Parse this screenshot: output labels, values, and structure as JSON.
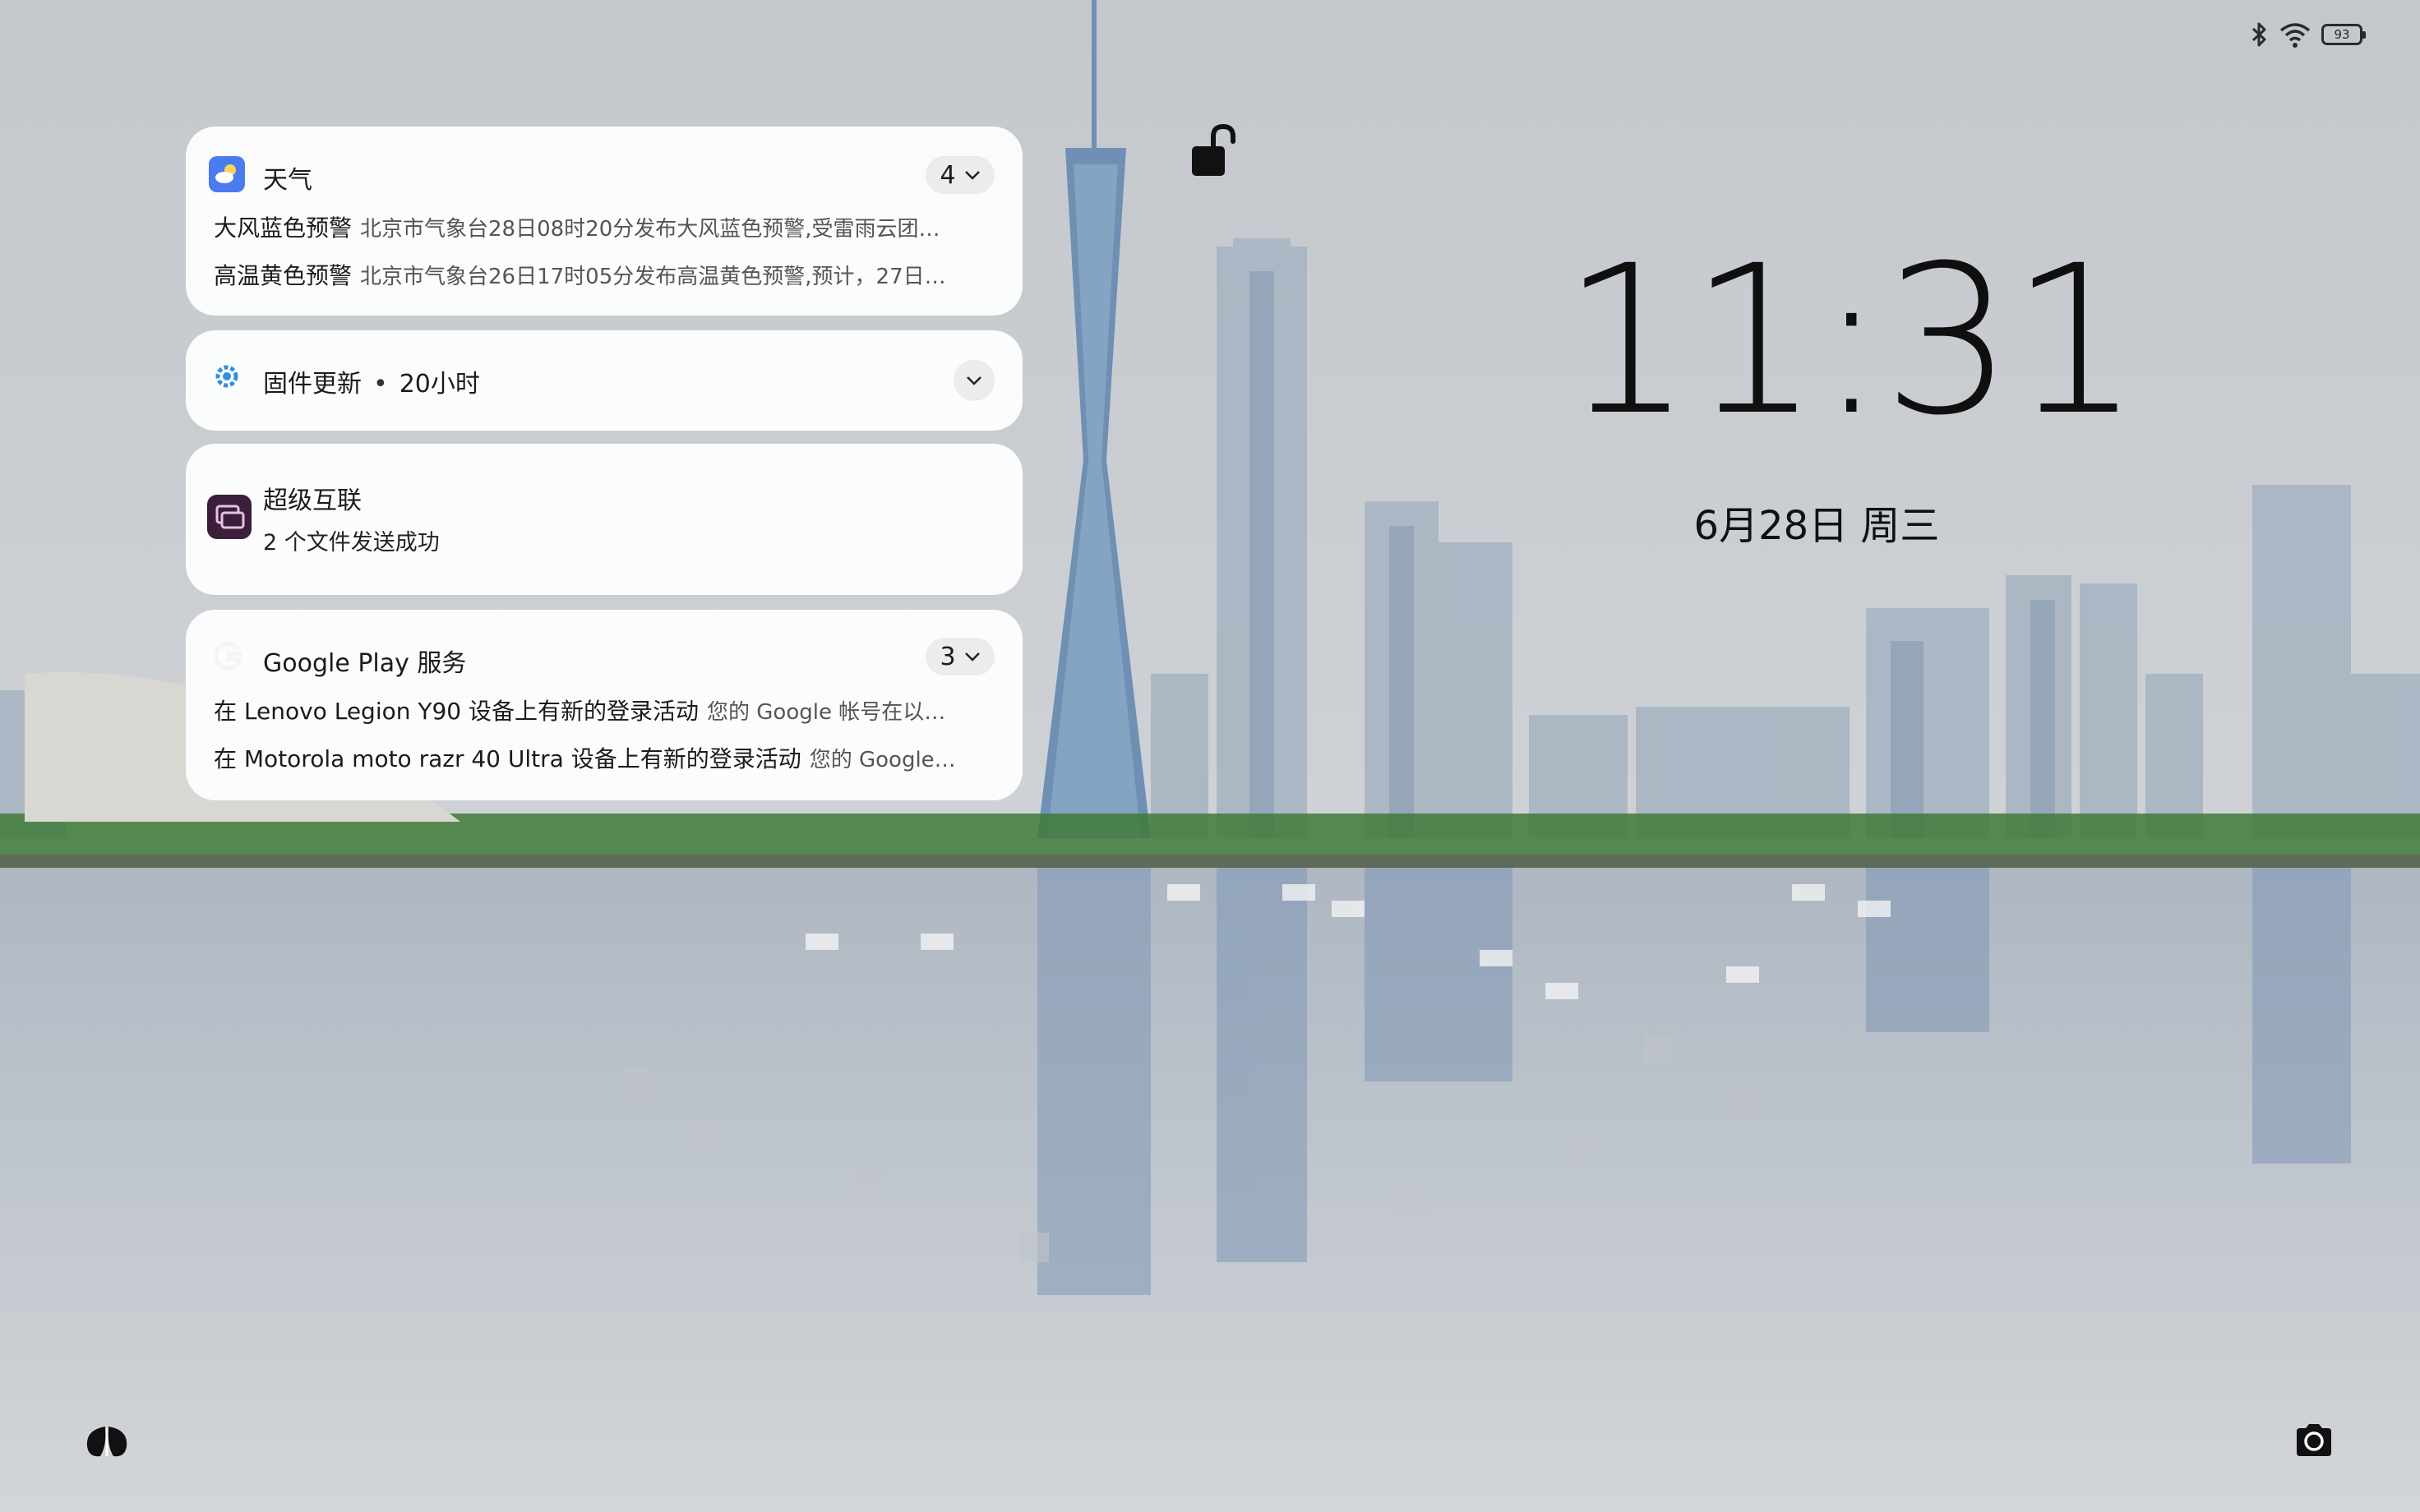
{
  "status_bar": {
    "battery": "93",
    "icons": [
      "bluetooth-icon",
      "wifi-icon",
      "battery-icon"
    ]
  },
  "lockscreen": {
    "time": "11:31",
    "date": "6月28日 周三"
  },
  "notifications": {
    "weather": {
      "app": "天气",
      "count": "4",
      "items": [
        {
          "title": "大风蓝色预警",
          "body": "北京市气象台28日08时20分发布大风蓝色预警,受雷雨云团…"
        },
        {
          "title": "高温黄色预警",
          "body": "北京市气象台26日17时05分发布高温黄色预警,预计，27日…"
        }
      ]
    },
    "firmware": {
      "app": "固件更新",
      "time": "20小时"
    },
    "super_link": {
      "app": "超级互联",
      "message": "2 个文件发送成功"
    },
    "google_play": {
      "app": "Google Play 服务",
      "count": "3",
      "items": [
        {
          "title": "在 Lenovo Legion Y90 设备上有新的登录活动",
          "body": "您的 Google 帐号在以…"
        },
        {
          "title": "在 Motorola moto razr 40 Ultra 设备上有新的登录活动",
          "body": "您的 Google…"
        }
      ]
    }
  },
  "colors": {
    "weather_icon": "#4a7cf0",
    "firmware_icon": "#2f8fe0",
    "super_link_icon": "#3b1f3a"
  }
}
